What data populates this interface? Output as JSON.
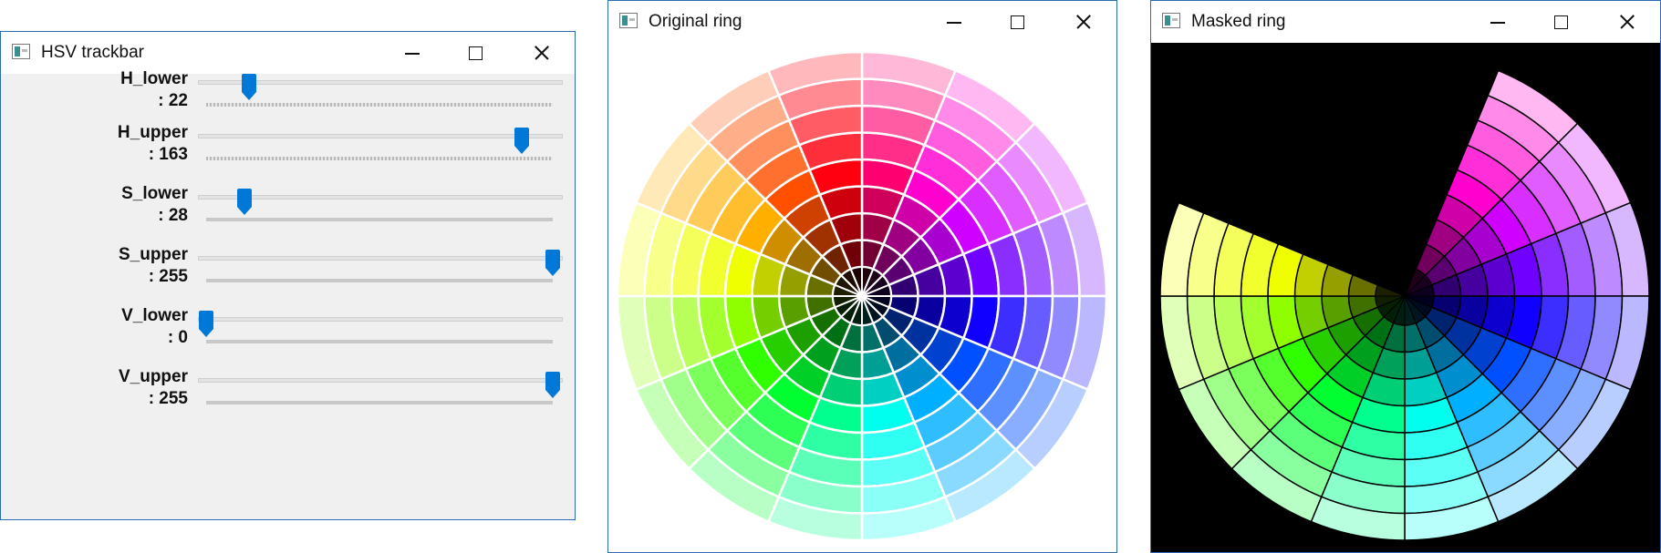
{
  "windows": {
    "trackbar": {
      "title": "HSV trackbar",
      "trackbars": [
        {
          "name": "H_lower",
          "value_label": ": 22",
          "value": 22,
          "max": 179
        },
        {
          "name": "H_upper",
          "value_label": ": 163",
          "value": 163,
          "max": 179
        },
        {
          "name": "S_lower",
          "value_label": ": 28",
          "value": 28,
          "max": 255
        },
        {
          "name": "S_upper",
          "value_label": ": 255",
          "value": 255,
          "max": 255
        },
        {
          "name": "V_lower",
          "value_label": ": 0",
          "value": 0,
          "max": 255
        },
        {
          "name": "V_upper",
          "value_label": ": 255",
          "value": 255,
          "max": 255
        }
      ]
    },
    "original": {
      "title": "Original ring"
    },
    "masked": {
      "title": "Masked ring"
    }
  },
  "colors": {
    "thumb": "#0078d7",
    "window_border": "#2b6db3"
  },
  "icons": {
    "app": "opencv-window-icon",
    "minimize": "minimize-icon",
    "maximize": "maximize-icon",
    "close": "close-icon"
  }
}
